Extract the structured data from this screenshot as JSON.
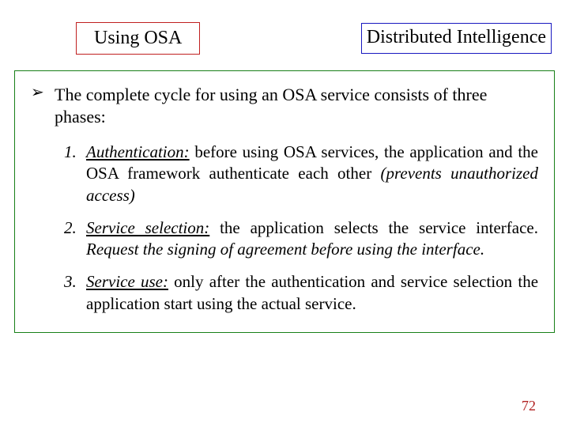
{
  "header": {
    "title": "Using OSA",
    "brand": "Distributed Intelligence"
  },
  "intro": "The complete cycle for using an OSA service consists of three phases:",
  "phases": {
    "p1_name": "Authentication:",
    "p1_lead": " before using OSA services, the application and the OSA framework authenticate each other ",
    "p1_paren": "(prevents unauthorized access)",
    "p2_name": "Service selection:",
    "p2_lead": " the application selects the service interface. ",
    "p2_tail": "Request the signing of agreement before using the interface.",
    "p3_name": "Service use:",
    "p3_lead": " only after the authentication and service selection the application start using the actual service."
  },
  "page_number": "72"
}
